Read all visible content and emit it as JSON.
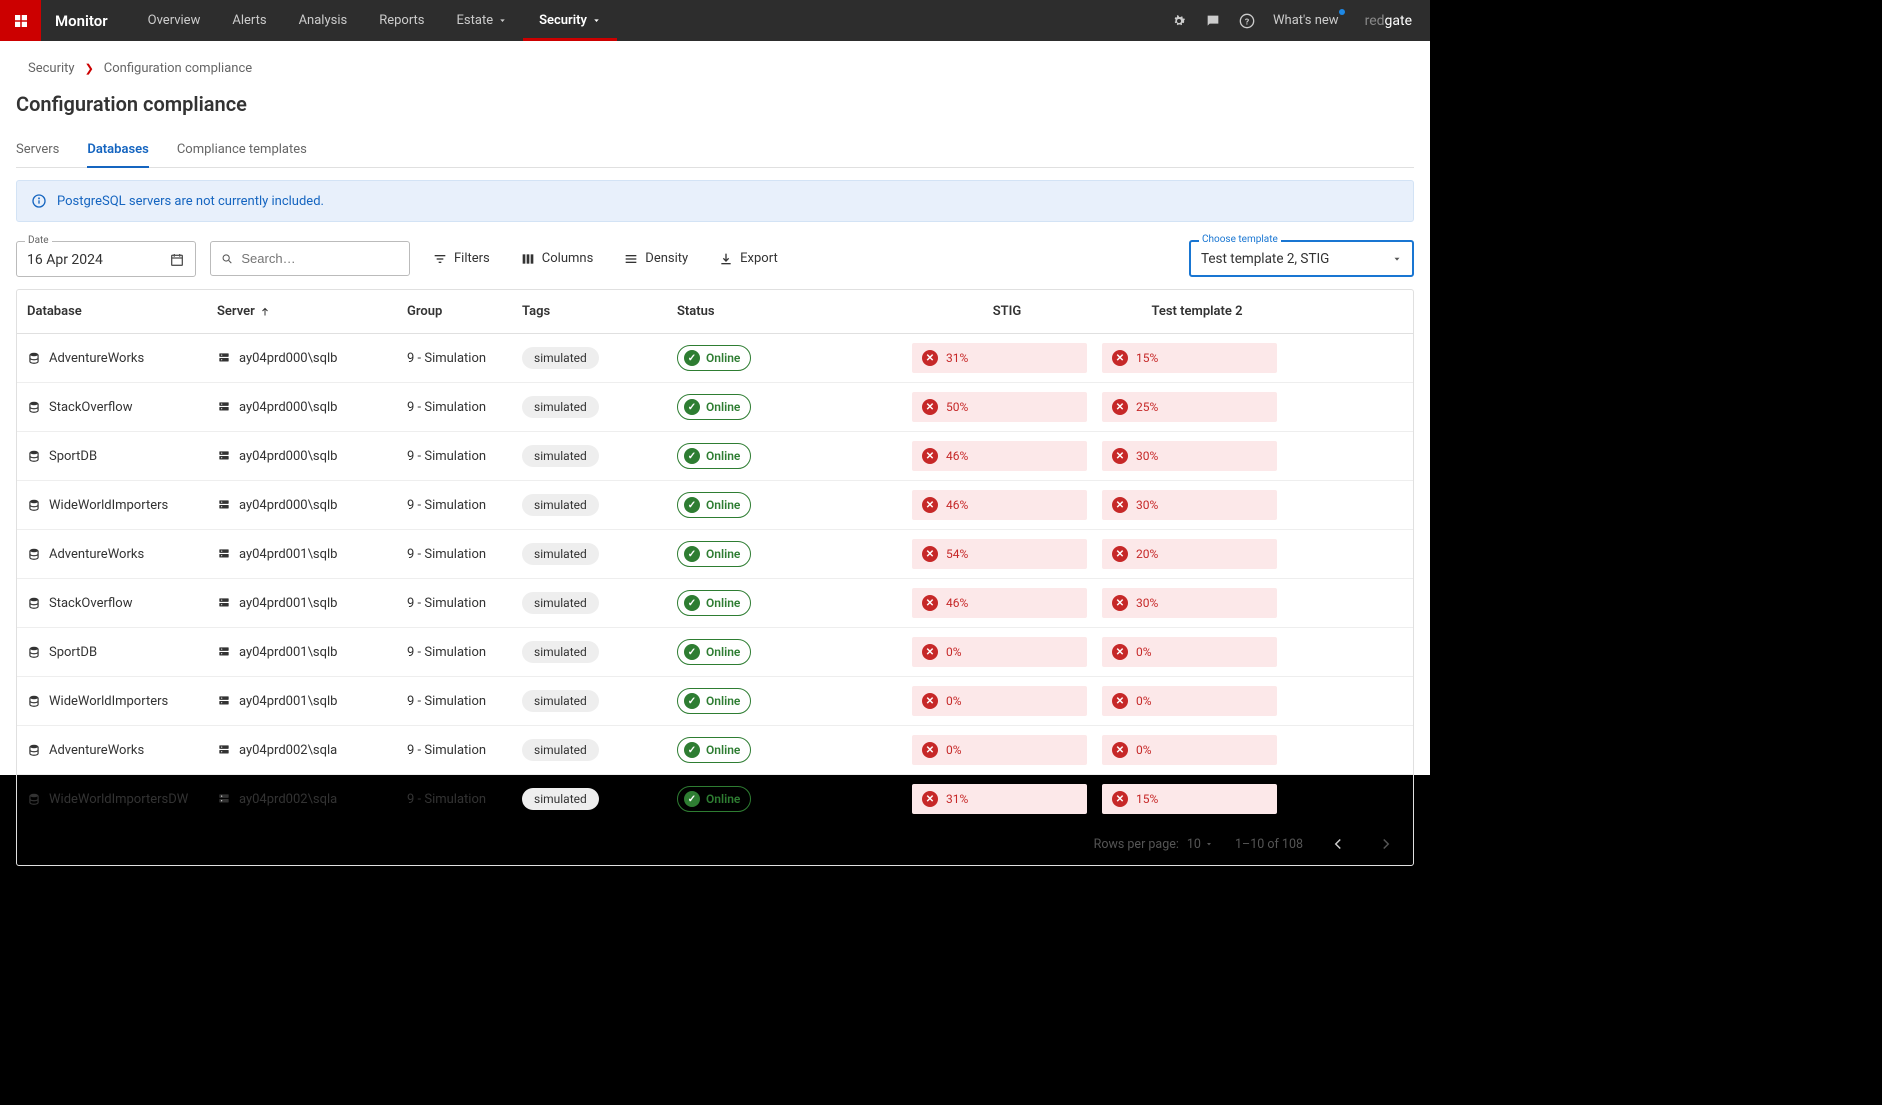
{
  "header": {
    "product": "Monitor",
    "nav": [
      "Overview",
      "Alerts",
      "Analysis",
      "Reports",
      "Estate",
      "Security"
    ],
    "whats_new": "What's new",
    "brand": "redgate"
  },
  "breadcrumb": {
    "root": "Security",
    "current": "Configuration compliance"
  },
  "page_title": "Configuration compliance",
  "tabs": [
    "Servers",
    "Databases",
    "Compliance templates"
  ],
  "banner": "PostgreSQL servers are not currently included.",
  "toolbar": {
    "date_label": "Date",
    "date_value": "16 Apr 2024",
    "search_placeholder": "Search…",
    "filters": "Filters",
    "columns": "Columns",
    "density": "Density",
    "export": "Export",
    "template_label": "Choose template",
    "template_value": "Test template 2, STIG"
  },
  "columns": [
    "Database",
    "Server",
    "Group",
    "Tags",
    "Status",
    "STIG",
    "Test template 2"
  ],
  "rows": [
    {
      "db": "AdventureWorks",
      "server": "ay04prd000\\sqlb",
      "group": "9 - Simulation",
      "tag": "simulated",
      "status": "Online",
      "stig": "31%",
      "tt2": "15%"
    },
    {
      "db": "StackOverflow",
      "server": "ay04prd000\\sqlb",
      "group": "9 - Simulation",
      "tag": "simulated",
      "status": "Online",
      "stig": "50%",
      "tt2": "25%"
    },
    {
      "db": "SportDB",
      "server": "ay04prd000\\sqlb",
      "group": "9 - Simulation",
      "tag": "simulated",
      "status": "Online",
      "stig": "46%",
      "tt2": "30%"
    },
    {
      "db": "WideWorldImporters",
      "server": "ay04prd000\\sqlb",
      "group": "9 - Simulation",
      "tag": "simulated",
      "status": "Online",
      "stig": "46%",
      "tt2": "30%"
    },
    {
      "db": "AdventureWorks",
      "server": "ay04prd001\\sqlb",
      "group": "9 - Simulation",
      "tag": "simulated",
      "status": "Online",
      "stig": "54%",
      "tt2": "20%"
    },
    {
      "db": "StackOverflow",
      "server": "ay04prd001\\sqlb",
      "group": "9 - Simulation",
      "tag": "simulated",
      "status": "Online",
      "stig": "46%",
      "tt2": "30%"
    },
    {
      "db": "SportDB",
      "server": "ay04prd001\\sqlb",
      "group": "9 - Simulation",
      "tag": "simulated",
      "status": "Online",
      "stig": "0%",
      "tt2": "0%"
    },
    {
      "db": "WideWorldImporters",
      "server": "ay04prd001\\sqlb",
      "group": "9 - Simulation",
      "tag": "simulated",
      "status": "Online",
      "stig": "0%",
      "tt2": "0%"
    },
    {
      "db": "AdventureWorks",
      "server": "ay04prd002\\sqla",
      "group": "9 - Simulation",
      "tag": "simulated",
      "status": "Online",
      "stig": "0%",
      "tt2": "0%"
    },
    {
      "db": "WideWorldImportersDW",
      "server": "ay04prd002\\sqla",
      "group": "9 - Simulation",
      "tag": "simulated",
      "status": "Online",
      "stig": "31%",
      "tt2": "15%"
    }
  ],
  "footer": {
    "rows_per_page_label": "Rows per page:",
    "rows_per_page_value": "10",
    "range": "1–10 of 108"
  }
}
